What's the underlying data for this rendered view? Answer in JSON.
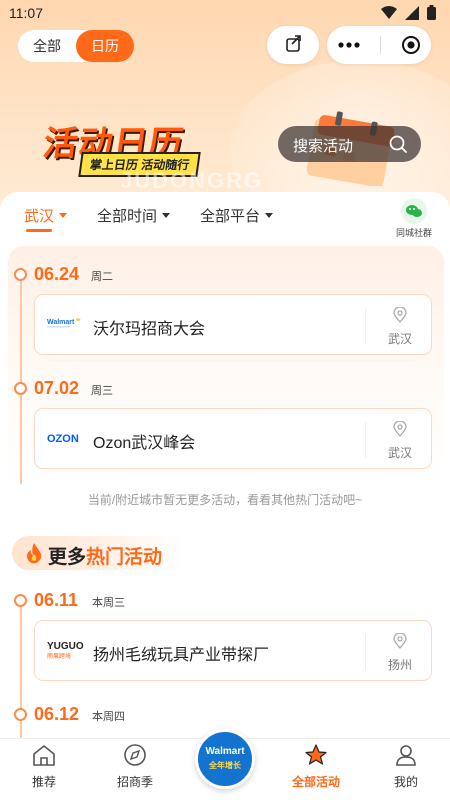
{
  "status": {
    "time": "11:07"
  },
  "header": {
    "segment": [
      "全部",
      "日历"
    ],
    "selected": "日历",
    "search_label": "搜索活动"
  },
  "banner": {
    "title": "活动日历",
    "tagline": "掌上日历 活动随行",
    "watermark": "JUDONGRG"
  },
  "filters": {
    "city": "武汉",
    "time": "全部时间",
    "platform": "全部平台",
    "wechat_group": "同城社群"
  },
  "events": [
    {
      "date": "06.24",
      "weekday": "周二",
      "brand": "Walmart",
      "title": "沃尔玛招商大会",
      "city": "武汉"
    },
    {
      "date": "07.02",
      "weekday": "周三",
      "brand": "OZON",
      "title": "Ozon武汉峰会",
      "city": "武汉"
    }
  ],
  "no_more_text": "当前/附近城市暂无更多活动，看看其他热门活动吧~",
  "hot": {
    "title_prefix": "更多",
    "title_accent": "热门活动",
    "events": [
      {
        "date": "06.11",
        "weekday": "本周三",
        "brand": "YUGUO",
        "brand_sub": "雨果跨境",
        "title": "扬州毛绒玩具产业带探厂",
        "city": "扬州"
      },
      {
        "date": "06.12",
        "weekday": "本周四"
      }
    ]
  },
  "tabbar": {
    "items": [
      "推荐",
      "招商季",
      "全部活动",
      "我的"
    ],
    "active": "全部活动",
    "center": {
      "line1": "Walmart",
      "line2": "全年增长"
    }
  },
  "colors": {
    "accent": "#ff6a1a",
    "walmart_blue": "#1274d0",
    "ozon_blue": "#005bff"
  }
}
